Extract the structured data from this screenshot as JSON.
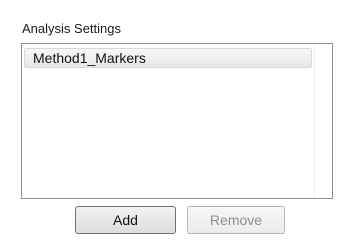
{
  "analysis_settings": {
    "title": "Analysis Settings",
    "items": [
      {
        "label": "Method1_Markers",
        "selected": true
      }
    ],
    "add_label": "Add",
    "remove_label": "Remove",
    "remove_enabled": false
  }
}
